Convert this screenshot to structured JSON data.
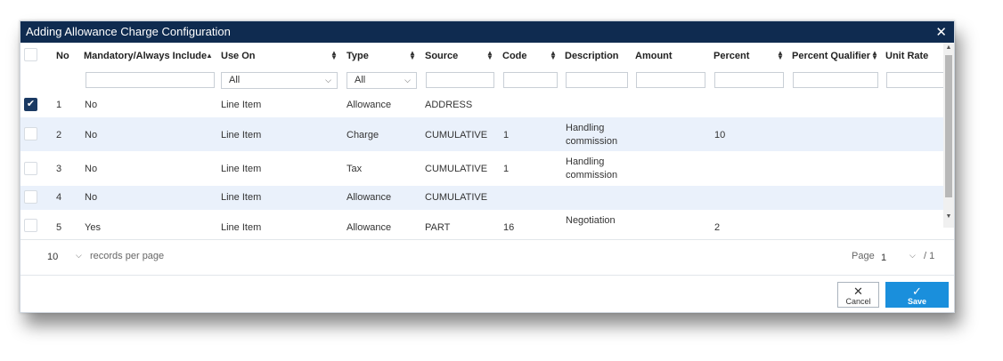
{
  "dialog": {
    "title": "Adding Allowance Charge Configuration"
  },
  "columns": {
    "no": "No",
    "mandatory": "Mandatory/Always Include",
    "use_on": "Use On",
    "type": "Type",
    "source": "Source",
    "code": "Code",
    "description": "Description",
    "amount": "Amount",
    "percent": "Percent",
    "percent_qualifier": "Percent Qualifier",
    "unit_rate": "Unit Rate"
  },
  "filters": {
    "use_on": "All",
    "type": "All"
  },
  "rows": [
    {
      "checked": true,
      "no": "1",
      "mandatory": "No",
      "use_on": "Line Item",
      "type": "Allowance",
      "source": "ADDRESS",
      "code": "",
      "desc1": "",
      "desc2": "",
      "percent": ""
    },
    {
      "checked": false,
      "no": "2",
      "mandatory": "No",
      "use_on": "Line Item",
      "type": "Charge",
      "source": "CUMULATIVE",
      "code": "1",
      "desc1": "Handling",
      "desc2": "commission",
      "percent": "10"
    },
    {
      "checked": false,
      "no": "3",
      "mandatory": "No",
      "use_on": "Line Item",
      "type": "Tax",
      "source": "CUMULATIVE",
      "code": "1",
      "desc1": "Handling",
      "desc2": "commission",
      "percent": ""
    },
    {
      "checked": false,
      "no": "4",
      "mandatory": "No",
      "use_on": "Line Item",
      "type": "Allowance",
      "source": "CUMULATIVE",
      "code": "",
      "desc1": "",
      "desc2": "",
      "percent": ""
    },
    {
      "checked": false,
      "no": "5",
      "mandatory": "Yes",
      "use_on": "Line Item",
      "type": "Allowance",
      "source": "PART",
      "code": "16",
      "desc1": "Negotiation",
      "desc2": "",
      "percent": "2"
    }
  ],
  "pagination": {
    "per_page": "10",
    "per_page_label": "records per page",
    "page_label": "Page",
    "page": "1",
    "total": "/ 1"
  },
  "buttons": {
    "cancel": "Cancel",
    "save": "Save"
  },
  "icons": {
    "close": "close-icon",
    "sort": "sort-icon",
    "checkmark": "checkmark-icon",
    "chevron": "chevron-down-icon"
  },
  "colors": {
    "titlebar": "#0f2b50",
    "row_alt": "#eaf1fb",
    "save_button": "#1a8fdc",
    "checkbox_checked": "#1b3a63"
  }
}
